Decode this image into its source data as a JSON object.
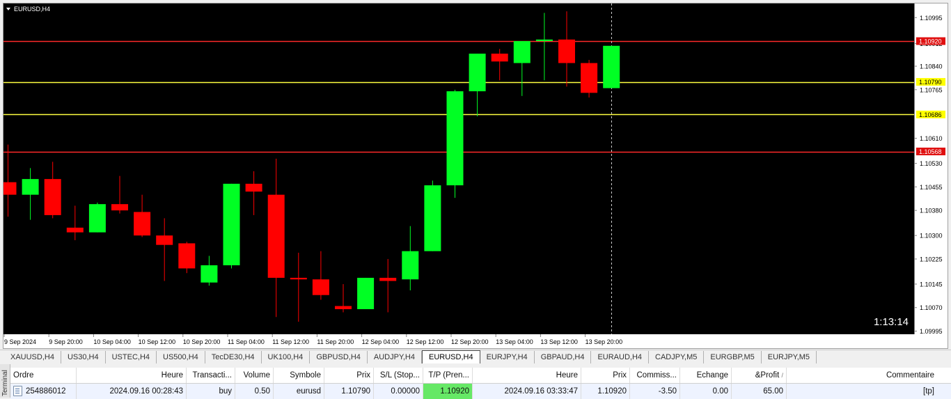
{
  "chart": {
    "title": "EURUSD,H4",
    "countdown": "1:13:14",
    "price_labels": [
      "1.10995",
      "1.10912",
      "1.10840",
      "1.10765",
      "1.10610",
      "1.10530",
      "1.10455",
      "1.10380",
      "1.10300",
      "1.10225",
      "1.10145",
      "1.10070",
      "1.09995"
    ],
    "time_labels": [
      "9 Sep 2024",
      "9 Sep 20:00",
      "10 Sep 04:00",
      "10 Sep 12:00",
      "10 Sep 20:00",
      "11 Sep 04:00",
      "11 Sep 12:00",
      "11 Sep 20:00",
      "12 Sep 04:00",
      "12 Sep 12:00",
      "12 Sep 20:00",
      "13 Sep 04:00",
      "13 Sep 12:00",
      "13 Sep 20:00"
    ],
    "levels": [
      {
        "price": 1.1092,
        "label": "1.10920",
        "color": "#ff2a2a",
        "tag_bg": "#e01010",
        "tag_fg": "#ffffff"
      },
      {
        "price": 1.1079,
        "label": "1.10790",
        "color": "#ffff40",
        "tag_bg": "#ffff00",
        "tag_fg": "#000000"
      },
      {
        "price": 1.10686,
        "label": "1.10686",
        "color": "#ffff40",
        "tag_bg": "#ffff00",
        "tag_fg": "#000000"
      },
      {
        "price": 1.10568,
        "label": "1.10568",
        "color": "#ff2a2a",
        "tag_bg": "#e01010",
        "tag_fg": "#ffffff"
      }
    ],
    "colors": {
      "bull": "#00ff24",
      "bear": "#ff0000",
      "background": "#000000"
    }
  },
  "chart_data": {
    "type": "candlestick",
    "series": [
      {
        "name": "EURUSD,H4",
        "candles": [
          {
            "o": 1.1047,
            "h": 1.1059,
            "l": 1.1036,
            "c": 1.1043
          },
          {
            "o": 1.1043,
            "h": 1.10515,
            "l": 1.1035,
            "c": 1.1048
          },
          {
            "o": 1.1048,
            "h": 1.10535,
            "l": 1.10355,
            "c": 1.10365
          },
          {
            "o": 1.10325,
            "h": 1.10395,
            "l": 1.10285,
            "c": 1.1031
          },
          {
            "o": 1.1031,
            "h": 1.10405,
            "l": 1.1031,
            "c": 1.104
          },
          {
            "o": 1.104,
            "h": 1.1049,
            "l": 1.1037,
            "c": 1.1038
          },
          {
            "o": 1.10375,
            "h": 1.1043,
            "l": 1.10295,
            "c": 1.103
          },
          {
            "o": 1.103,
            "h": 1.10355,
            "l": 1.10155,
            "c": 1.1027
          },
          {
            "o": 1.10275,
            "h": 1.1028,
            "l": 1.1018,
            "c": 1.10195
          },
          {
            "o": 1.1015,
            "h": 1.10235,
            "l": 1.1014,
            "c": 1.10205
          },
          {
            "o": 1.10205,
            "h": 1.10465,
            "l": 1.10195,
            "c": 1.10465
          },
          {
            "o": 1.10465,
            "h": 1.10505,
            "l": 1.10365,
            "c": 1.1044
          },
          {
            "o": 1.1043,
            "h": 1.10545,
            "l": 1.1004,
            "c": 1.10165
          },
          {
            "o": 1.10165,
            "h": 1.10245,
            "l": 1.10025,
            "c": 1.1016
          },
          {
            "o": 1.1016,
            "h": 1.1025,
            "l": 1.10095,
            "c": 1.1011
          },
          {
            "o": 1.10075,
            "h": 1.10145,
            "l": 1.10055,
            "c": 1.10065
          },
          {
            "o": 1.10065,
            "h": 1.10165,
            "l": 1.10065,
            "c": 1.10165
          },
          {
            "o": 1.10165,
            "h": 1.10225,
            "l": 1.10055,
            "c": 1.10155
          },
          {
            "o": 1.1016,
            "h": 1.1033,
            "l": 1.10125,
            "c": 1.1025
          },
          {
            "o": 1.1025,
            "h": 1.10475,
            "l": 1.1025,
            "c": 1.1046
          },
          {
            "o": 1.1046,
            "h": 1.10765,
            "l": 1.1042,
            "c": 1.1076
          },
          {
            "o": 1.1076,
            "h": 1.1088,
            "l": 1.1068,
            "c": 1.1088
          },
          {
            "o": 1.1088,
            "h": 1.10895,
            "l": 1.10795,
            "c": 1.10855
          },
          {
            "o": 1.1085,
            "h": 1.1092,
            "l": 1.10745,
            "c": 1.1092
          },
          {
            "o": 1.1092,
            "h": 1.1101,
            "l": 1.10795,
            "c": 1.10925
          },
          {
            "o": 1.10925,
            "h": 1.11015,
            "l": 1.10775,
            "c": 1.1085
          },
          {
            "o": 1.1085,
            "h": 1.1086,
            "l": 1.1074,
            "c": 1.10755
          },
          {
            "o": 1.1077,
            "h": 1.10905,
            "l": 1.1077,
            "c": 1.10905
          }
        ]
      }
    ],
    "ylim": [
      1.09985,
      1.1104
    ],
    "grid": false,
    "legend": "none"
  },
  "tabs": [
    "XAUUSD,H4",
    "US30,H4",
    "USTEC,H4",
    "US500,H4",
    "TecDE30,H4",
    "UK100,H4",
    "GBPUSD,H4",
    "AUDJPY,H4",
    "EURUSD,H4",
    "EURJPY,H4",
    "GBPAUD,H4",
    "EURAUD,H4",
    "CADJPY,M5",
    "EURGBP,M5",
    "EURJPY,M5"
  ],
  "active_tab": "EURUSD,H4",
  "terminal_label": "Terminal",
  "trades": {
    "headers": [
      "Ordre",
      "Heure",
      "Transacti...",
      "Volume",
      "Symbole",
      "Prix",
      "S/L (Stop...",
      "T/P (Pren...",
      "Heure",
      "Prix",
      "Commiss...",
      "Echange",
      "&Profit",
      "Commentaire"
    ],
    "profit_sort_mark": "/",
    "rows": [
      {
        "ordre": "254886012",
        "heure": "2024.09.16 00:28:43",
        "transaction": "buy",
        "volume": "0.50",
        "symbole": "eurusd",
        "prix": "1.10790",
        "sl": "0.00000",
        "tp": "1.10920",
        "heure2": "2024.09.16 03:33:47",
        "prix2": "1.10920",
        "commission": "-3.50",
        "echange": "0.00",
        "profit": "65.00",
        "commentaire": "[tp]"
      }
    ]
  }
}
